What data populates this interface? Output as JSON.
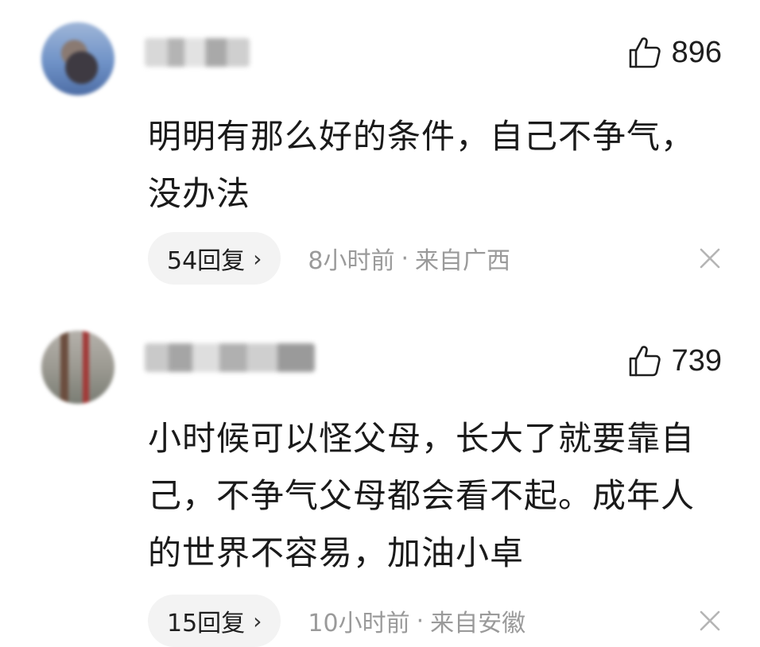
{
  "comments": [
    {
      "likes": "896",
      "text": "明明有那么好的条件，自己不争气，没办法",
      "replies": "54回复",
      "time": "8小时前",
      "location": "来自广西"
    },
    {
      "likes": "739",
      "text": "小时候可以怪父母，长大了就要靠自己，不争气父母都会看不起。成年人的世界不容易，加油小卓",
      "replies": "15回复",
      "time": "10小时前",
      "location": "来自安徽"
    }
  ],
  "icons": {
    "like": "thumbs-up-outline-icon",
    "close": "close-icon",
    "chevron": "chevron-right-icon"
  },
  "separator": "·",
  "chevron_glyph": "›"
}
